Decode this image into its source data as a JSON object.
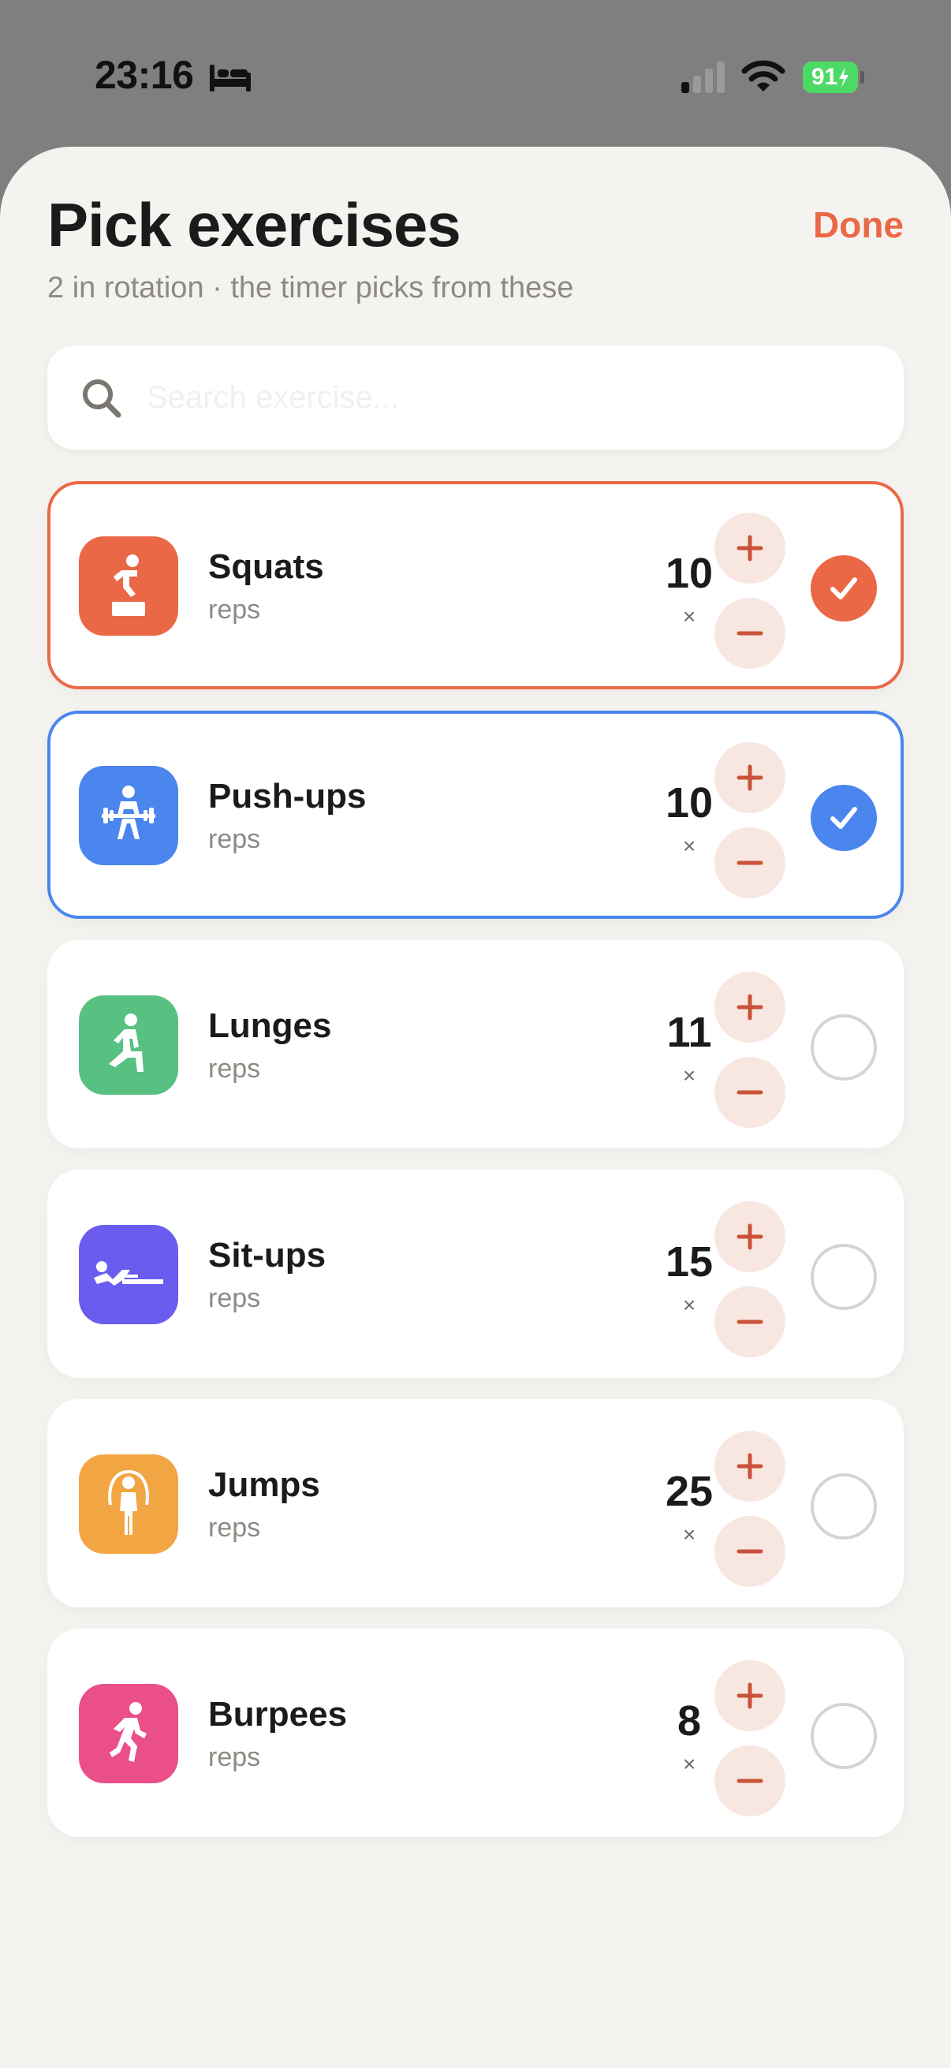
{
  "status_bar": {
    "time": "23:16",
    "battery": "91"
  },
  "header": {
    "title": "Pick exercises",
    "done_label": "Done",
    "subtitle": "2 in rotation · the timer picks from these"
  },
  "search": {
    "placeholder": "Search exercise..."
  },
  "colors": {
    "accent": "#ea6845",
    "squats": "#ea6845",
    "pushups": "#4b86ee",
    "lunges": "#58c182",
    "situps": "#6b5cf0",
    "jumps": "#f2a543",
    "burpees": "#ea4f8a"
  },
  "exercises": [
    {
      "name": "Squats",
      "unit": "reps",
      "count": "10",
      "times": "×",
      "selected": true,
      "icon": "step-up-icon"
    },
    {
      "name": "Push-ups",
      "unit": "reps",
      "count": "10",
      "times": "×",
      "selected": true,
      "icon": "weightlifter-icon"
    },
    {
      "name": "Lunges",
      "unit": "reps",
      "count": "11",
      "times": "×",
      "selected": false,
      "icon": "lunge-icon"
    },
    {
      "name": "Sit-ups",
      "unit": "reps",
      "count": "15",
      "times": "×",
      "selected": false,
      "icon": "situp-icon"
    },
    {
      "name": "Jumps",
      "unit": "reps",
      "count": "25",
      "times": "×",
      "selected": false,
      "icon": "jump-rope-icon"
    },
    {
      "name": "Burpees",
      "unit": "reps",
      "count": "8",
      "times": "×",
      "selected": false,
      "icon": "runner-icon"
    }
  ]
}
